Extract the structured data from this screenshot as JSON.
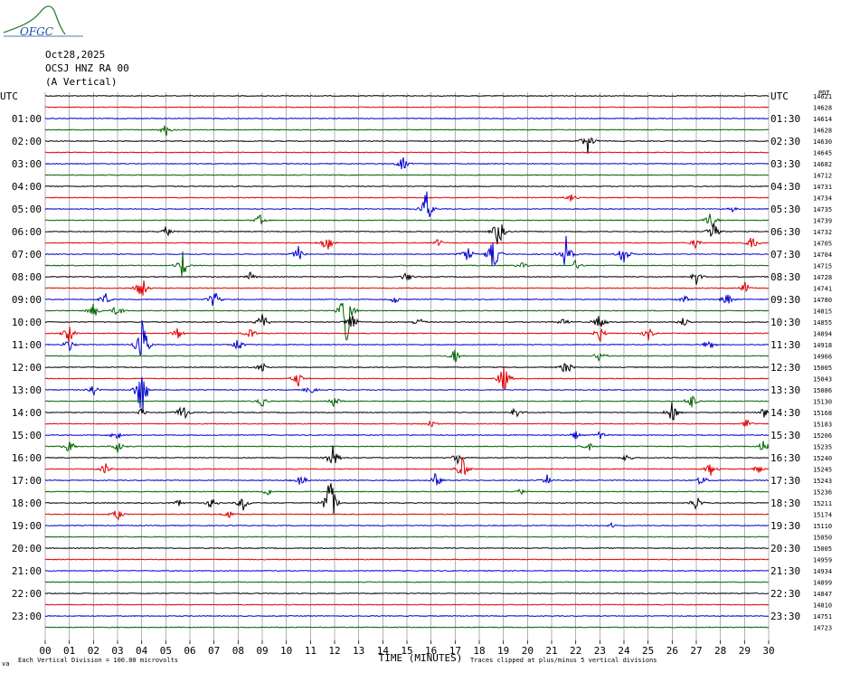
{
  "logo": {
    "text": "OFGC",
    "color": "#1f4e9c"
  },
  "header": {
    "date": "Oct28,2025",
    "station": "OCSJ HNZ RA 00",
    "component": "(A Vertical)"
  },
  "footer": {
    "axis_title": "TIME (MINUTES)",
    "vertical_division": "Each Vertical Division =  100.00 microvolts",
    "clip_note": "Traces clipped at plus/minus 5 vertical divisions",
    "corner_mark": "va"
  },
  "chart_data": {
    "type": "line",
    "title": "",
    "xlabel": "TIME (MINUTES)",
    "ylabel": "",
    "xlim": [
      0,
      30
    ],
    "grid": true,
    "left_axis_title": "UTC",
    "right_axis_title": "UTC",
    "right_corner_label": "PDT",
    "x_ticks": [
      "00",
      "01",
      "02",
      "03",
      "04",
      "05",
      "06",
      "07",
      "08",
      "09",
      "10",
      "11",
      "12",
      "13",
      "14",
      "15",
      "16",
      "17",
      "18",
      "19",
      "20",
      "21",
      "22",
      "23",
      "24",
      "25",
      "26",
      "27",
      "28",
      "29",
      "30"
    ],
    "trace_colors": [
      "#000000",
      "#e00000",
      "#0000d0",
      "#006400"
    ],
    "left_labels": [
      "UTC",
      "01:00",
      "02:00",
      "03:00",
      "04:00",
      "05:00",
      "06:00",
      "07:00",
      "08:00",
      "09:00",
      "10:00",
      "11:00",
      "12:00",
      "13:00",
      "14:00",
      "15:00",
      "16:00",
      "17:00",
      "18:00",
      "19:00",
      "20:00",
      "21:00",
      "22:00",
      "23:00"
    ],
    "right_labels": [
      "UTC",
      "01:30",
      "02:30",
      "03:30",
      "04:30",
      "05:30",
      "06:30",
      "07:30",
      "08:30",
      "09:30",
      "10:30",
      "11:30",
      "12:30",
      "13:30",
      "14:30",
      "15:30",
      "16:30",
      "17:30",
      "18:30",
      "19:30",
      "20:30",
      "21:30",
      "22:30",
      "23:30"
    ],
    "trace_values": [
      14621,
      14628,
      14614,
      14628,
      14630,
      14645,
      14682,
      14712,
      14731,
      14734,
      14735,
      14739,
      14732,
      14705,
      14704,
      14715,
      14728,
      14741,
      14780,
      14815,
      14855,
      14894,
      14918,
      14966,
      15005,
      15043,
      15086,
      15130,
      15168,
      15183,
      15206,
      15235,
      15240,
      15245,
      15243,
      15236,
      15211,
      15174,
      15110,
      15050,
      15005,
      14959,
      14934,
      14899,
      14847,
      14810,
      14751,
      14723
    ],
    "events": [
      {
        "row": 3,
        "minute": 5.0,
        "amp": 1.2
      },
      {
        "row": 4,
        "minute": 22.5,
        "amp": 2.2
      },
      {
        "row": 6,
        "minute": 14.8,
        "amp": 1.5
      },
      {
        "row": 9,
        "minute": 21.8,
        "amp": 0.8
      },
      {
        "row": 10,
        "minute": 15.8,
        "amp": 3.5
      },
      {
        "row": 10,
        "minute": 28.5,
        "amp": 0.6
      },
      {
        "row": 11,
        "minute": 8.9,
        "amp": 1.0
      },
      {
        "row": 11,
        "minute": 27.6,
        "amp": 2.0
      },
      {
        "row": 12,
        "minute": 5.0,
        "amp": 1.2
      },
      {
        "row": 12,
        "minute": 18.8,
        "amp": 3.0
      },
      {
        "row": 12,
        "minute": 27.7,
        "amp": 2.5
      },
      {
        "row": 13,
        "minute": 11.7,
        "amp": 2.0
      },
      {
        "row": 13,
        "minute": 16.3,
        "amp": 0.8
      },
      {
        "row": 13,
        "minute": 27.0,
        "amp": 1.2
      },
      {
        "row": 13,
        "minute": 29.3,
        "amp": 1.5
      },
      {
        "row": 14,
        "minute": 10.5,
        "amp": 1.5
      },
      {
        "row": 14,
        "minute": 17.5,
        "amp": 1.5
      },
      {
        "row": 14,
        "minute": 18.6,
        "amp": 3.5
      },
      {
        "row": 14,
        "minute": 21.6,
        "amp": 3.0
      },
      {
        "row": 14,
        "minute": 24.0,
        "amp": 2.2
      },
      {
        "row": 15,
        "minute": 5.7,
        "amp": 2.5
      },
      {
        "row": 15,
        "minute": 19.8,
        "amp": 0.6
      },
      {
        "row": 15,
        "minute": 22.0,
        "amp": 1.0
      },
      {
        "row": 16,
        "minute": 8.5,
        "amp": 0.8
      },
      {
        "row": 16,
        "minute": 15.0,
        "amp": 1.0
      },
      {
        "row": 16,
        "minute": 27.0,
        "amp": 1.5
      },
      {
        "row": 17,
        "minute": 4.0,
        "amp": 2.5
      },
      {
        "row": 17,
        "minute": 29.0,
        "amp": 1.2
      },
      {
        "row": 18,
        "minute": 2.5,
        "amp": 1.2
      },
      {
        "row": 18,
        "minute": 7.0,
        "amp": 2.0
      },
      {
        "row": 18,
        "minute": 14.5,
        "amp": 0.8
      },
      {
        "row": 18,
        "minute": 26.5,
        "amp": 1.0
      },
      {
        "row": 18,
        "minute": 28.3,
        "amp": 1.5
      },
      {
        "row": 19,
        "minute": 2.0,
        "amp": 1.5
      },
      {
        "row": 19,
        "minute": 3.0,
        "amp": 1.5
      },
      {
        "row": 19,
        "minute": 12.5,
        "amp": 6.0
      },
      {
        "row": 20,
        "minute": 9.0,
        "amp": 2.0
      },
      {
        "row": 20,
        "minute": 12.7,
        "amp": 2.0
      },
      {
        "row": 20,
        "minute": 15.5,
        "amp": 1.0
      },
      {
        "row": 20,
        "minute": 21.5,
        "amp": 1.0
      },
      {
        "row": 20,
        "minute": 23.0,
        "amp": 2.0
      },
      {
        "row": 20,
        "minute": 26.5,
        "amp": 1.0
      },
      {
        "row": 21,
        "minute": 1.0,
        "amp": 1.8
      },
      {
        "row": 21,
        "minute": 5.5,
        "amp": 1.2
      },
      {
        "row": 21,
        "minute": 8.5,
        "amp": 1.2
      },
      {
        "row": 21,
        "minute": 23.0,
        "amp": 1.5
      },
      {
        "row": 21,
        "minute": 25.0,
        "amp": 1.2
      },
      {
        "row": 22,
        "minute": 1.0,
        "amp": 1.2
      },
      {
        "row": 22,
        "minute": 4.0,
        "amp": 6.0
      },
      {
        "row": 22,
        "minute": 8.0,
        "amp": 1.5
      },
      {
        "row": 22,
        "minute": 27.5,
        "amp": 1.2
      },
      {
        "row": 23,
        "minute": 17.0,
        "amp": 1.5
      },
      {
        "row": 23,
        "minute": 23.0,
        "amp": 1.5
      },
      {
        "row": 24,
        "minute": 9.0,
        "amp": 1.0
      },
      {
        "row": 24,
        "minute": 21.6,
        "amp": 1.5
      },
      {
        "row": 25,
        "minute": 10.5,
        "amp": 1.5
      },
      {
        "row": 25,
        "minute": 19.0,
        "amp": 3.0
      },
      {
        "row": 26,
        "minute": 2.0,
        "amp": 1.2
      },
      {
        "row": 26,
        "minute": 4.0,
        "amp": 6.0
      },
      {
        "row": 26,
        "minute": 11.0,
        "amp": 1.0
      },
      {
        "row": 27,
        "minute": 9.0,
        "amp": 1.0
      },
      {
        "row": 27,
        "minute": 12.0,
        "amp": 1.0
      },
      {
        "row": 27,
        "minute": 26.8,
        "amp": 1.5
      },
      {
        "row": 28,
        "minute": 4.0,
        "amp": 1.0
      },
      {
        "row": 28,
        "minute": 5.7,
        "amp": 2.0
      },
      {
        "row": 28,
        "minute": 19.5,
        "amp": 1.2
      },
      {
        "row": 28,
        "minute": 26.0,
        "amp": 2.0
      },
      {
        "row": 28,
        "minute": 29.8,
        "amp": 1.0
      },
      {
        "row": 29,
        "minute": 16.0,
        "amp": 0.8
      },
      {
        "row": 29,
        "minute": 29.1,
        "amp": 1.0
      },
      {
        "row": 30,
        "minute": 3.0,
        "amp": 1.2
      },
      {
        "row": 30,
        "minute": 22.0,
        "amp": 0.8
      },
      {
        "row": 30,
        "minute": 23.0,
        "amp": 0.8
      },
      {
        "row": 31,
        "minute": 1.0,
        "amp": 1.5
      },
      {
        "row": 31,
        "minute": 3.0,
        "amp": 1.2
      },
      {
        "row": 31,
        "minute": 22.5,
        "amp": 1.0
      },
      {
        "row": 31,
        "minute": 29.8,
        "amp": 1.2
      },
      {
        "row": 32,
        "minute": 11.9,
        "amp": 2.5
      },
      {
        "row": 32,
        "minute": 17.1,
        "amp": 1.0
      },
      {
        "row": 32,
        "minute": 24.1,
        "amp": 0.8
      },
      {
        "row": 33,
        "minute": 2.5,
        "amp": 1.2
      },
      {
        "row": 33,
        "minute": 17.3,
        "amp": 2.5
      },
      {
        "row": 33,
        "minute": 27.6,
        "amp": 1.2
      },
      {
        "row": 33,
        "minute": 29.6,
        "amp": 1.0
      },
      {
        "row": 34,
        "minute": 10.6,
        "amp": 1.2
      },
      {
        "row": 34,
        "minute": 16.2,
        "amp": 1.5
      },
      {
        "row": 34,
        "minute": 20.8,
        "amp": 1.0
      },
      {
        "row": 34,
        "minute": 27.2,
        "amp": 1.2
      },
      {
        "row": 35,
        "minute": 9.2,
        "amp": 0.8
      },
      {
        "row": 35,
        "minute": 19.7,
        "amp": 0.6
      },
      {
        "row": 36,
        "minute": 5.6,
        "amp": 0.8
      },
      {
        "row": 36,
        "minute": 6.9,
        "amp": 1.2
      },
      {
        "row": 36,
        "minute": 8.2,
        "amp": 1.5
      },
      {
        "row": 36,
        "minute": 11.8,
        "amp": 6.0
      },
      {
        "row": 36,
        "minute": 27.0,
        "amp": 1.5
      },
      {
        "row": 37,
        "minute": 3.0,
        "amp": 1.2
      },
      {
        "row": 37,
        "minute": 7.6,
        "amp": 1.0
      },
      {
        "row": 38,
        "minute": 23.5,
        "amp": 0.5
      }
    ]
  }
}
